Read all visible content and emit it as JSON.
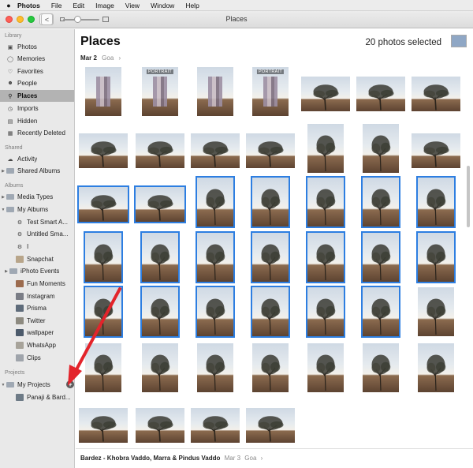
{
  "menubar": {
    "apple": "",
    "app": "Photos",
    "items": [
      "File",
      "Edit",
      "Image",
      "View",
      "Window",
      "Help"
    ]
  },
  "toolbar": {
    "back": "<",
    "title": "Places"
  },
  "sidebar": {
    "library_header": "Library",
    "library": [
      {
        "label": "Photos",
        "icon": "photos-icon"
      },
      {
        "label": "Memories",
        "icon": "memories-icon"
      },
      {
        "label": "Favorites",
        "icon": "heart-icon"
      },
      {
        "label": "People",
        "icon": "person-icon"
      },
      {
        "label": "Places",
        "icon": "pin-icon",
        "selected": true
      },
      {
        "label": "Imports",
        "icon": "clock-icon"
      },
      {
        "label": "Hidden",
        "icon": "eye-slash-icon"
      },
      {
        "label": "Recently Deleted",
        "icon": "trash-icon"
      }
    ],
    "shared_header": "Shared",
    "shared": [
      {
        "label": "Activity",
        "icon": "cloud-icon"
      },
      {
        "label": "Shared Albums",
        "icon": "shared-album-icon"
      }
    ],
    "albums_header": "Albums",
    "albums": [
      {
        "label": "Media Types",
        "icon": "folder-icon"
      },
      {
        "label": "My Albums",
        "icon": "folder-icon"
      },
      {
        "label": "Test Smart A...",
        "icon": "smart-album-icon"
      },
      {
        "label": "Untitled Sma...",
        "icon": "smart-album-icon"
      },
      {
        "label": "I",
        "icon": "smart-album-icon"
      },
      {
        "label": "Snapchat",
        "icon": "album-icon"
      },
      {
        "label": "iPhoto Events",
        "icon": "folder-icon"
      },
      {
        "label": "Fun Moments",
        "icon": "album-icon"
      },
      {
        "label": "Instagram",
        "icon": "album-icon"
      },
      {
        "label": "Prisma",
        "icon": "album-icon"
      },
      {
        "label": "Twitter",
        "icon": "album-icon"
      },
      {
        "label": "wallpaper",
        "icon": "album-icon"
      },
      {
        "label": "WhatsApp",
        "icon": "album-icon"
      },
      {
        "label": "Clips",
        "icon": "album-icon"
      }
    ],
    "projects_header": "Projects",
    "projects": [
      {
        "label": "My Projects",
        "icon": "folder-icon"
      },
      {
        "label": "Panaji & Bard...",
        "icon": "project-icon"
      }
    ],
    "add_button": "+"
  },
  "main": {
    "title": "Places",
    "selected_count": "20 photos selected",
    "section1": {
      "date": "Mar 2",
      "place": "Goa",
      "chevron": "›"
    },
    "portrait_tag": "PORTRAIT",
    "section2": {
      "place": "Bardez - Khobra Vaddo, Marra & Pindus Vaddo",
      "date": "Mar 3",
      "region": "Goa",
      "chevron": "›"
    }
  },
  "colors": {
    "selection": "#2d7ee1",
    "sidebar_selected": "#b3b3b3",
    "annotation_arrow": "#e3242b"
  }
}
